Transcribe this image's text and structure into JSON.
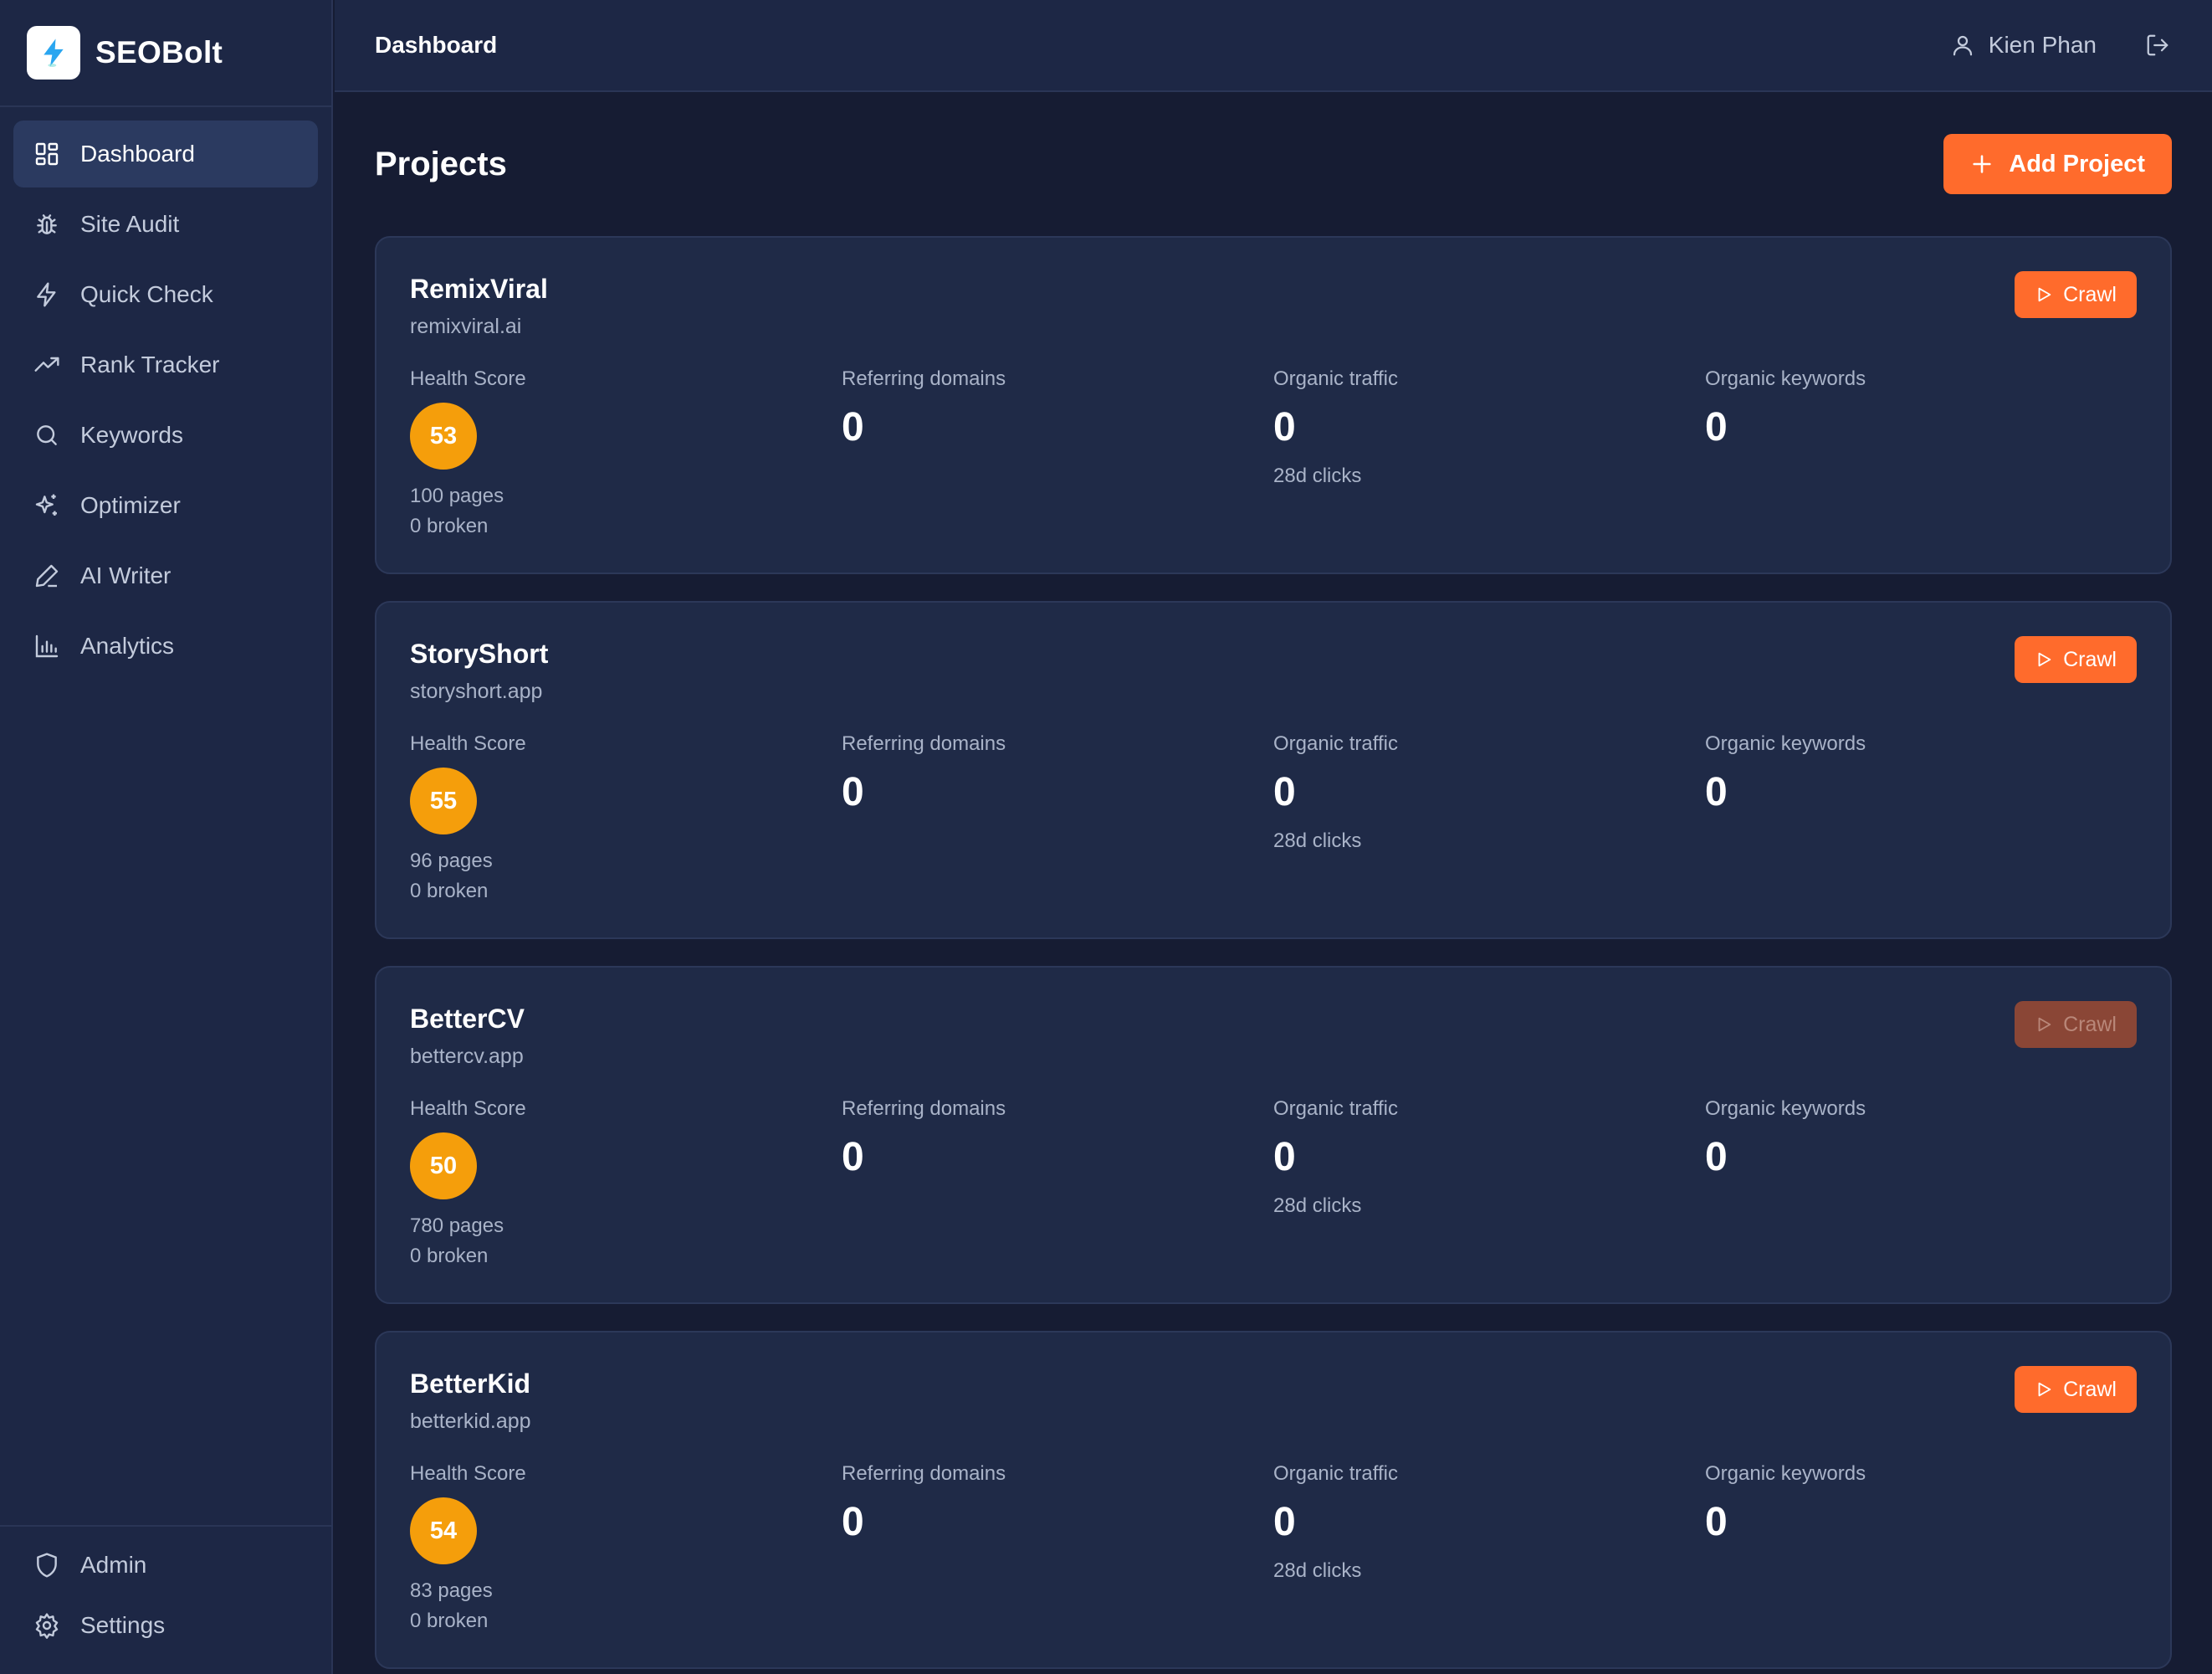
{
  "app": {
    "name": "SEOBolt",
    "logo_icon": "bolt-icon"
  },
  "sidebar": {
    "items": [
      {
        "label": "Dashboard",
        "icon": "dashboard-grid-icon",
        "active": true
      },
      {
        "label": "Site Audit",
        "icon": "bug-icon"
      },
      {
        "label": "Quick Check",
        "icon": "zap-icon"
      },
      {
        "label": "Rank Tracker",
        "icon": "trending-up-icon"
      },
      {
        "label": "Keywords",
        "icon": "search-icon"
      },
      {
        "label": "Optimizer",
        "icon": "sparkles-icon"
      },
      {
        "label": "AI Writer",
        "icon": "pen-icon"
      },
      {
        "label": "Analytics",
        "icon": "bar-chart-icon"
      }
    ],
    "bottom_items": [
      {
        "label": "Admin",
        "icon": "shield-icon"
      },
      {
        "label": "Settings",
        "icon": "gear-icon"
      }
    ]
  },
  "topbar": {
    "breadcrumb": "Dashboard",
    "user_name": "Kien Phan"
  },
  "main": {
    "title": "Projects",
    "add_button": "Add Project"
  },
  "labels": {
    "health_score": "Health Score",
    "referring_domains": "Referring domains",
    "organic_traffic": "Organic traffic",
    "organic_keywords": "Organic keywords",
    "clicks_sub": "28d clicks",
    "crawl": "Crawl"
  },
  "projects": [
    {
      "name": "RemixViral",
      "domain": "remixviral.ai",
      "health_score": "53",
      "pages": "100 pages",
      "broken": "0 broken",
      "referring_domains": "0",
      "organic_traffic": "0",
      "organic_keywords": "0",
      "crawl_enabled": true
    },
    {
      "name": "StoryShort",
      "domain": "storyshort.app",
      "health_score": "55",
      "pages": "96 pages",
      "broken": "0 broken",
      "referring_domains": "0",
      "organic_traffic": "0",
      "organic_keywords": "0",
      "crawl_enabled": true
    },
    {
      "name": "BetterCV",
      "domain": "bettercv.app",
      "health_score": "50",
      "pages": "780 pages",
      "broken": "0 broken",
      "referring_domains": "0",
      "organic_traffic": "0",
      "organic_keywords": "0",
      "crawl_enabled": false
    },
    {
      "name": "BetterKid",
      "domain": "betterkid.app",
      "health_score": "54",
      "pages": "83 pages",
      "broken": "0 broken",
      "referring_domains": "0",
      "organic_traffic": "0",
      "organic_keywords": "0",
      "crawl_enabled": true
    }
  ],
  "colors": {
    "accent": "#ff6b2c",
    "score": "#f59e0b",
    "background": "#161c33",
    "panel": "#1d2745",
    "card": "#1f2a47"
  }
}
